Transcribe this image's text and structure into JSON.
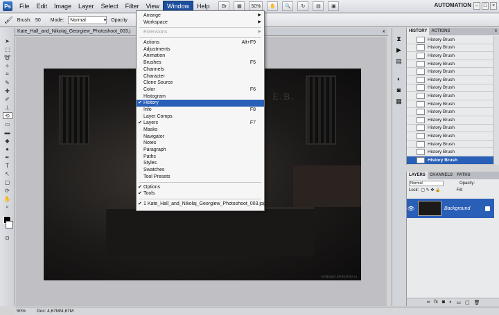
{
  "menubar": {
    "logo": "Ps",
    "items": [
      "File",
      "Edit",
      "Image",
      "Layer",
      "Select",
      "Filter",
      "View",
      "Window",
      "Help"
    ],
    "zoom": "50%",
    "workspace": "AUTOMATION"
  },
  "options_bar": {
    "brush_label": "Brush:",
    "brush_size": "50",
    "mode_label": "Mode:",
    "mode_value": "Normal",
    "opacity_label": "Opacity"
  },
  "document": {
    "tab_title": "Kate_Hall_and_Nikolaj_Georgiew_Photoshoot_003.j",
    "photo_letters": "E.B.",
    "photo_credit": "wallpaper.photoshop.ru"
  },
  "window_menu": {
    "items": [
      {
        "label": "Arrange",
        "submenu": true
      },
      {
        "label": "Workspace",
        "submenu": true
      },
      {
        "sep": true
      },
      {
        "label": "Extensions",
        "submenu": true,
        "disabled": true
      },
      {
        "sep": true
      },
      {
        "label": "Actions",
        "shortcut": "Alt+F9"
      },
      {
        "label": "Adjustments"
      },
      {
        "label": "Animation"
      },
      {
        "label": "Brushes",
        "shortcut": "F5"
      },
      {
        "label": "Channels"
      },
      {
        "label": "Character"
      },
      {
        "label": "Clone Source"
      },
      {
        "label": "Color",
        "shortcut": "F6"
      },
      {
        "label": "Histogram"
      },
      {
        "label": "History",
        "checked": true,
        "highlighted": true
      },
      {
        "label": "Info",
        "shortcut": "F8"
      },
      {
        "label": "Layer Comps"
      },
      {
        "label": "Layers",
        "checked": true,
        "shortcut": "F7"
      },
      {
        "label": "Masks"
      },
      {
        "label": "Navigator"
      },
      {
        "label": "Notes"
      },
      {
        "label": "Paragraph"
      },
      {
        "label": "Paths"
      },
      {
        "label": "Styles"
      },
      {
        "label": "Swatches"
      },
      {
        "label": "Tool Presets"
      },
      {
        "sep": true
      },
      {
        "label": "Options",
        "checked": true
      },
      {
        "label": "Tools",
        "checked": true
      },
      {
        "sep": true
      },
      {
        "label": "1 Kate_Hall_and_Nikolaj_Georgiew_Photoshoot_003.jpg",
        "checked": true
      }
    ]
  },
  "history_panel": {
    "tabs": [
      "HISTORY",
      "ACTIONS"
    ],
    "entries": [
      "History Brush",
      "History Brush",
      "History Brush",
      "History Brush",
      "History Brush",
      "History Brush",
      "History Brush",
      "History Brush",
      "History Brush",
      "History Brush",
      "History Brush",
      "History Brush",
      "History Brush",
      "History Brush",
      "History Brush",
      "History Brush"
    ],
    "selected_index": 15
  },
  "layers_panel": {
    "tabs": [
      "LAYERS",
      "CHANNELS",
      "PATHS"
    ],
    "blend_mode": "Normal",
    "opacity_label": "Opacity:",
    "lock_label": "Lock:",
    "fill_label": "Fill:",
    "layer_name": "Background"
  },
  "statusbar": {
    "zoom": "50%",
    "doc_info": "Doc: 4,67M/4,67M"
  },
  "colors": {
    "accent": "#2a5fb8",
    "menu_active": "#1e4f9e"
  }
}
